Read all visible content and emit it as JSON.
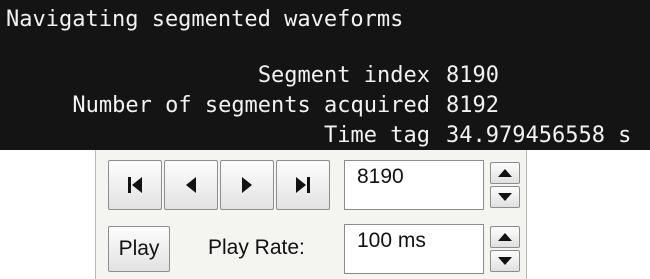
{
  "info": {
    "title": "Navigating segmented waveforms",
    "rows": [
      {
        "label": "Segment index",
        "value": "8190"
      },
      {
        "label": "Number of segments acquired",
        "value": "8192"
      },
      {
        "label": "Time tag",
        "value": "34.979456558 s"
      }
    ],
    "colors": {
      "background": "#141414",
      "text": "#f2f2f2"
    }
  },
  "controls": {
    "nav_buttons": [
      {
        "icon": "skip-to-first-icon"
      },
      {
        "icon": "previous-icon"
      },
      {
        "icon": "next-icon"
      },
      {
        "icon": "skip-to-last-icon"
      }
    ],
    "segment_field_value": "8190",
    "play_label": "Play",
    "play_rate_label": "Play Rate:",
    "play_rate_value": "100 ms",
    "colors": {
      "panel": "#f4f4f0",
      "border": "#8d8d8d"
    }
  }
}
